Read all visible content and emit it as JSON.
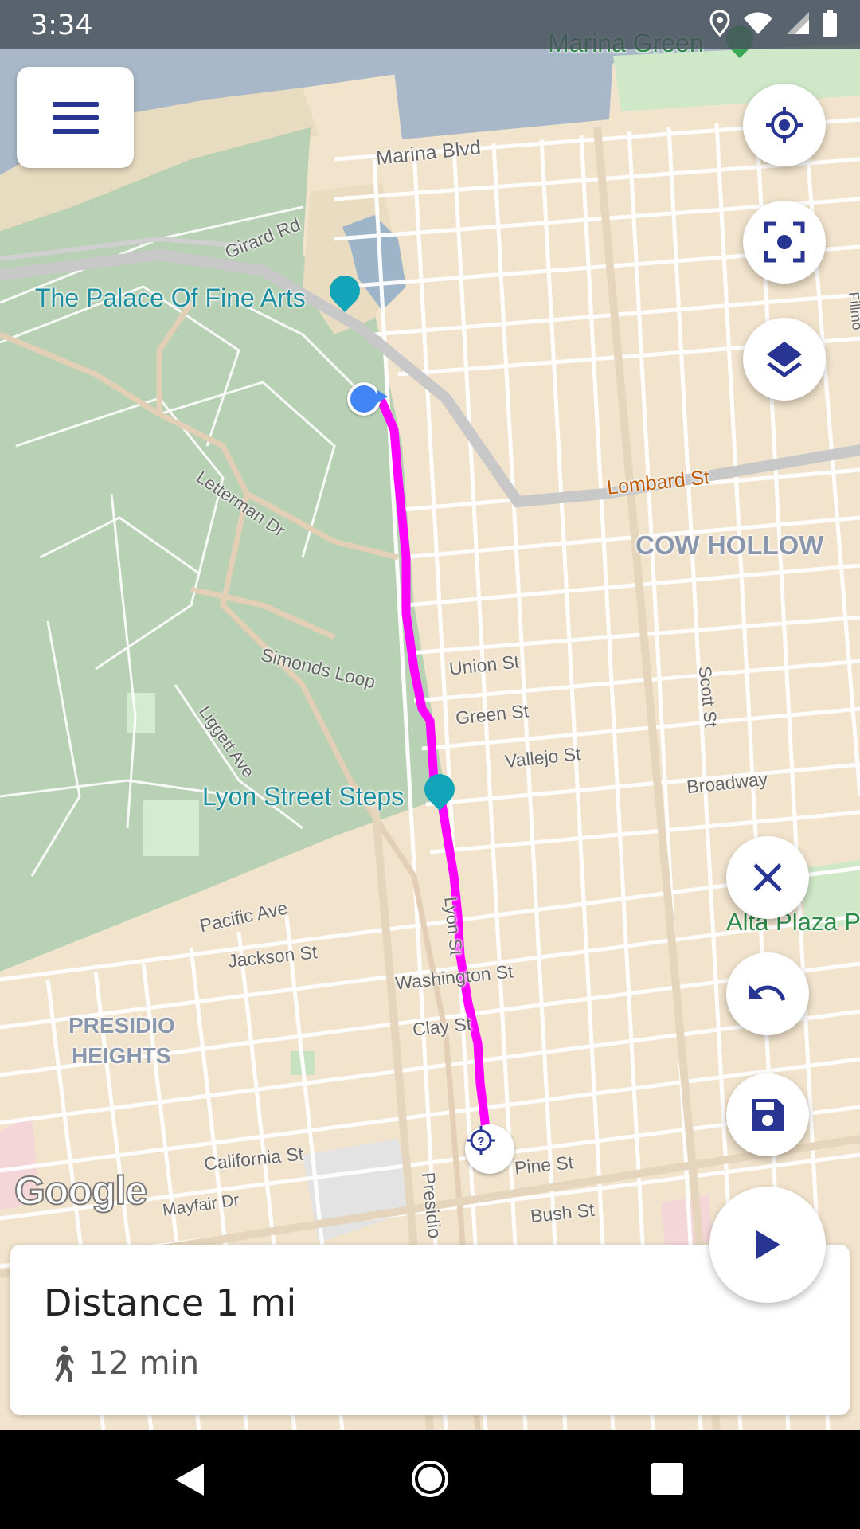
{
  "status_bar": {
    "time": "3:34",
    "icons": [
      "location-icon",
      "wifi-icon",
      "signal-icon",
      "battery-icon"
    ]
  },
  "map": {
    "labels": {
      "marina_green": "Marina Green",
      "marina_blvd": "Marina Blvd",
      "girard_rd": "Girard Rd",
      "palace_of_fine_arts": "The Palace Of Fine Arts",
      "lombard_st": "Lombard St",
      "cow_hollow": "COW HOLLOW",
      "letterman_dr": "Letterman Dr",
      "simonds_loop": "Simonds Loop",
      "union_st": "Union St",
      "green_st": "Green St",
      "vallejo_st": "Vallejo St",
      "scott_st": "Scott St",
      "broadway": "Broadway",
      "liggett_ave": "Liggett Ave",
      "lyon_street_steps": "Lyon Street Steps",
      "alta_plaza": "Alta Plaza P",
      "pacific_ave": "Pacific Ave",
      "jackson_st": "Jackson St",
      "lyon_st": "Lyon St",
      "washington_st": "Washington St",
      "presidio_heights_1": "PRESIDIO",
      "presidio_heights_2": "HEIGHTS",
      "clay_st": "Clay St",
      "california_st": "California St",
      "presidio": "Presidio",
      "pine_st": "Pine St",
      "mayfair_dr": "Mayfair Dr",
      "bush_st": "Bush St",
      "fillmore": "Fillmo"
    },
    "route_color": "#ff00ff",
    "google_logo": "Google"
  },
  "controls": {
    "menu_icon": "menu-icon",
    "my_location_icon": "my-location-icon",
    "center_focus_icon": "center-focus-icon",
    "layers_icon": "layers-icon",
    "close_icon": "close-icon",
    "undo_icon": "undo-icon",
    "save_icon": "save-icon",
    "play_icon": "play-icon"
  },
  "route_info": {
    "distance": "Distance 1 mi",
    "duration": "12 min",
    "mode_icon": "walking-icon"
  },
  "accent_color": "#283593"
}
